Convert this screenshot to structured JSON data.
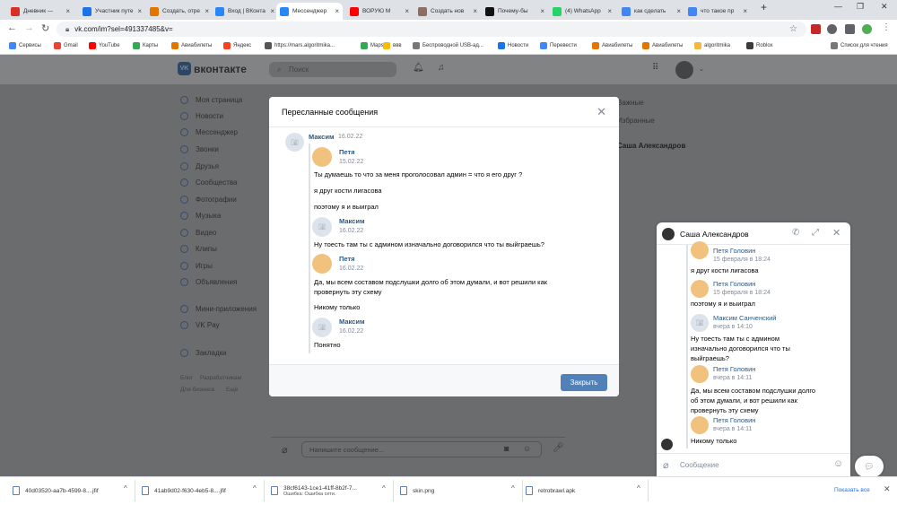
{
  "browser": {
    "tabs": [
      {
        "title": "Дневник —",
        "color": "#d93025"
      },
      {
        "title": "Участник путе",
        "color": "#1a73e8"
      },
      {
        "title": "Создать, отре",
        "color": "#e37400"
      },
      {
        "title": "Вход | ВКонта",
        "color": "#2787f5"
      },
      {
        "title": "Мессенджер",
        "color": "#2787f5"
      },
      {
        "title": "ВОРУЮ М",
        "color": "#ff0000"
      },
      {
        "title": "Создать нов",
        "color": "#8d6e63"
      },
      {
        "title": "Почему-бы",
        "color": "#111111"
      },
      {
        "title": "(4) WhatsApp",
        "color": "#25d366"
      },
      {
        "title": "как сделать",
        "color": "#4285f4"
      },
      {
        "title": "что такое пр",
        "color": "#4285f4"
      }
    ],
    "active_tab": 4,
    "new_tab": "+",
    "url": "vk.com/im?sel=491337485&v=",
    "bookmarks": [
      {
        "label": "Сервисы",
        "color": "#4285f4"
      },
      {
        "label": "Gmail",
        "color": "#ea4335"
      },
      {
        "label": "YouTube",
        "color": "#ff0000"
      },
      {
        "label": "Карты",
        "color": "#34a853"
      },
      {
        "label": "Авиабилеты",
        "color": "#e37400"
      },
      {
        "label": "Яндекс",
        "color": "#fc3f1d"
      },
      {
        "label": "https://mars.algoritmika...",
        "color": "#555555"
      },
      {
        "label": "Maps",
        "color": "#34a853"
      },
      {
        "label": "ввв",
        "color": "#fbbc04"
      },
      {
        "label": "Беспроводной USB-ад...",
        "color": "#777777"
      },
      {
        "label": "Новости",
        "color": "#1a73e8"
      },
      {
        "label": "Перевести",
        "color": "#4285f4"
      },
      {
        "label": "Авиабилеты",
        "color": "#e37400"
      },
      {
        "label": "Авиабилеты",
        "color": "#e37400"
      },
      {
        "label": "algoritmika",
        "color": "#f6b73c"
      },
      {
        "label": "Roblox",
        "color": "#393b3d"
      }
    ],
    "reading_list": "Список для чтения"
  },
  "vk": {
    "logo_text": "вконтакте",
    "search_placeholder": "Поиск",
    "menu": [
      "Моя страница",
      "Новости",
      "Мессенджер",
      "Звонки",
      "Друзья",
      "Сообщества",
      "Фотографии",
      "Музыка",
      "Видео",
      "Клипы",
      "Игры",
      "Объявления",
      "Мини-приложения",
      "VK Pay",
      "Закладки"
    ],
    "footer_links": [
      "Блог",
      "Разработчикам",
      "Для бизнеса",
      "Ещё"
    ],
    "side_list": [
      "Важные",
      "Избранные",
      "Саша Александров"
    ],
    "compose_placeholder": "Напишите сообщение..."
  },
  "modal": {
    "title": "Пересланные сообщения",
    "close_button": "Закрыть",
    "sender": "Максим",
    "sender_date": "16.02.22",
    "messages": [
      {
        "name": "Петя",
        "date": "15.02.22",
        "texts": [
          "Ты думаешь то что за меня проголосовал админ = что я его друг ?",
          "я друг кости лигасова",
          "поэтому я и выиграл"
        ]
      },
      {
        "name": "Максим",
        "date": "16.02.22",
        "texts": [
          "Ну тоесть там ты с админом изначально договорился что ты выйграешь?"
        ]
      },
      {
        "name": "Петя",
        "date": "16.02.22",
        "texts": [
          "Да, мы всем составом подслушки долго об этом думали, и вот решили как провернуть эту схему",
          "Никому только"
        ]
      },
      {
        "name": "Максим",
        "date": "16.02.22",
        "texts": [
          "Понятно"
        ]
      }
    ]
  },
  "chat": {
    "title": "Саша Александров",
    "input_placeholder": "Сообщение",
    "messages": [
      {
        "name": "Петя Головин",
        "date": "15 февраля в 18:24",
        "text": "я друг кости лигасова"
      },
      {
        "name": "Петя Головин",
        "date": "15 февраля в 18:24",
        "text": "поэтому я и выиграл"
      },
      {
        "name": "Максим Санченский",
        "date": "вчера в 14:10",
        "text": "Ну тоесть там ты с админом изначально договорился что ты выйграешь?"
      },
      {
        "name": "Петя Головин",
        "date": "вчера в 14:11",
        "text": "Да, мы всем составом подслушки долго об этом думали, и вот решили как провернуть эту схему"
      },
      {
        "name": "Петя Головин",
        "date": "вчера в 14:11",
        "text": "Никому только"
      }
    ]
  },
  "downloads": {
    "items": [
      {
        "name": "40d03520-aa7b-4599-8....jfif",
        "sub": ""
      },
      {
        "name": "41ab9d02-f630-4eb5-8....jfif",
        "sub": ""
      },
      {
        "name": "38cf6143-1ce1-41ff-8b2f-7...",
        "sub": "Ошибка: Ошибка сети."
      },
      {
        "name": "skin.png",
        "sub": ""
      },
      {
        "name": "retrobrawl.apk",
        "sub": ""
      }
    ],
    "show_all": "Показать все"
  }
}
